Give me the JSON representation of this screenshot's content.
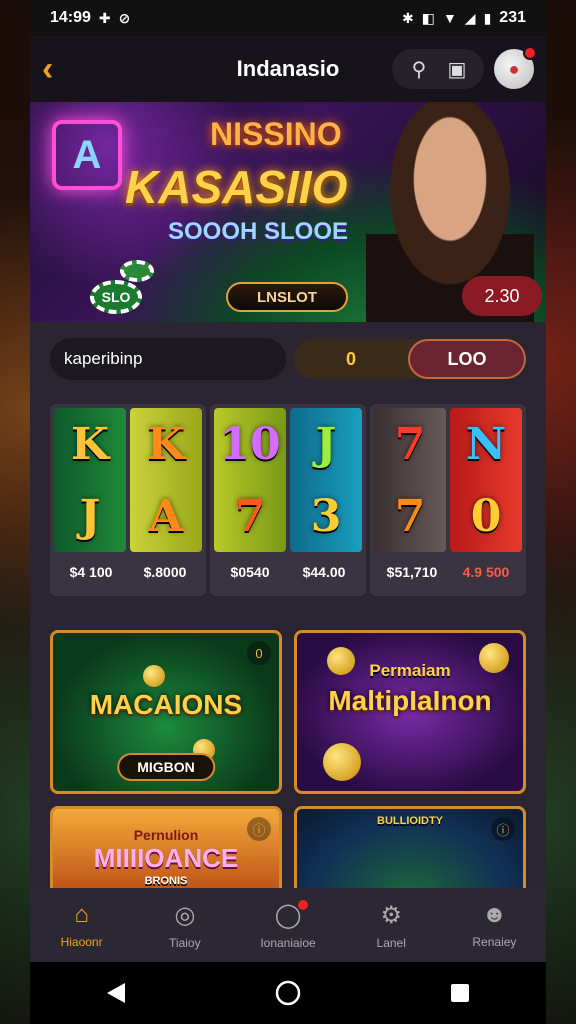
{
  "status": {
    "time": "14:99",
    "battery": "231"
  },
  "appbar": {
    "title": "Indanasio"
  },
  "banner": {
    "title_top": "NISSINO",
    "title_main": "KASASIIO",
    "subtitle": "SOOOH SLOOE",
    "cta_label": "LNSLOT",
    "chip_label": "SLO",
    "badge_value": "2.30",
    "neon_letter": "A"
  },
  "search": {
    "value": "kaperibinp"
  },
  "toggle": {
    "option_a": "0",
    "option_b": "LOO"
  },
  "slots": [
    {
      "reels": [
        [
          "K",
          "J"
        ],
        [
          "K",
          "A"
        ]
      ],
      "prices": [
        "$4 100",
        "$.8000"
      ]
    },
    {
      "reels": [
        [
          "10",
          "7"
        ],
        [
          "J",
          "3"
        ]
      ],
      "prices": [
        "$0540",
        "$44.00"
      ]
    },
    {
      "reels": [
        [
          "7",
          "7"
        ],
        [
          "N",
          "0"
        ]
      ],
      "prices": [
        "$51,710",
        "4.9 500"
      ]
    }
  ],
  "tiles": [
    {
      "title": "MACAIONS",
      "button": "MIGBON",
      "corner": "0"
    },
    {
      "title_small": "Permaiam",
      "title": "MaltipIaInon"
    },
    {
      "title_small": "Pernulion",
      "title": "MIIIIOANCE",
      "sub": "BRONIS"
    },
    {
      "title_small": "BULLIOIDTY"
    }
  ],
  "nav": [
    {
      "label": "Hiaoonr",
      "icon": "home-icon",
      "active": true
    },
    {
      "label": "Tiaioy",
      "icon": "lock-icon",
      "active": false
    },
    {
      "label": "Ionaniaioe",
      "icon": "chat-icon",
      "active": false,
      "dot": true
    },
    {
      "label": "Lanel",
      "icon": "gear-icon",
      "active": false
    },
    {
      "label": "Renaiey",
      "icon": "user-icon",
      "active": false
    }
  ],
  "colors": {
    "accent": "#f0a224",
    "background": "#1f1b24",
    "badge": "#8a1a24"
  }
}
